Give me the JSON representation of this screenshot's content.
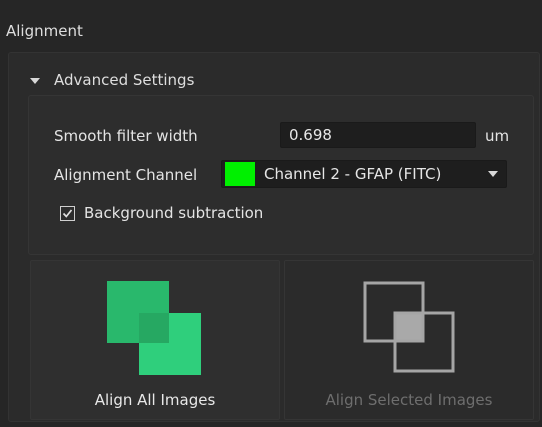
{
  "panel": {
    "title": "Alignment"
  },
  "advanced": {
    "header": "Advanced Settings",
    "expanded": true,
    "smooth_filter": {
      "label": "Smooth filter width",
      "value": "0.698",
      "unit": "um"
    },
    "alignment_channel": {
      "label": "Alignment Channel",
      "selected": "Channel 2 - GFAP (FITC)",
      "swatch_color": "#00f000"
    },
    "background_subtraction": {
      "label": "Background subtraction",
      "checked": true
    }
  },
  "buttons": {
    "align_all": {
      "label": "Align All Images",
      "enabled": true,
      "icon_color": "#2ecc7a"
    },
    "align_selected": {
      "label": "Align Selected Images",
      "enabled": false,
      "icon_color": "#9a9a9a"
    }
  },
  "colors": {
    "background": "#262626",
    "text": "#e4e4e4",
    "disabled_text": "#6e6e6e",
    "accent_green": "#2ecc7a"
  }
}
